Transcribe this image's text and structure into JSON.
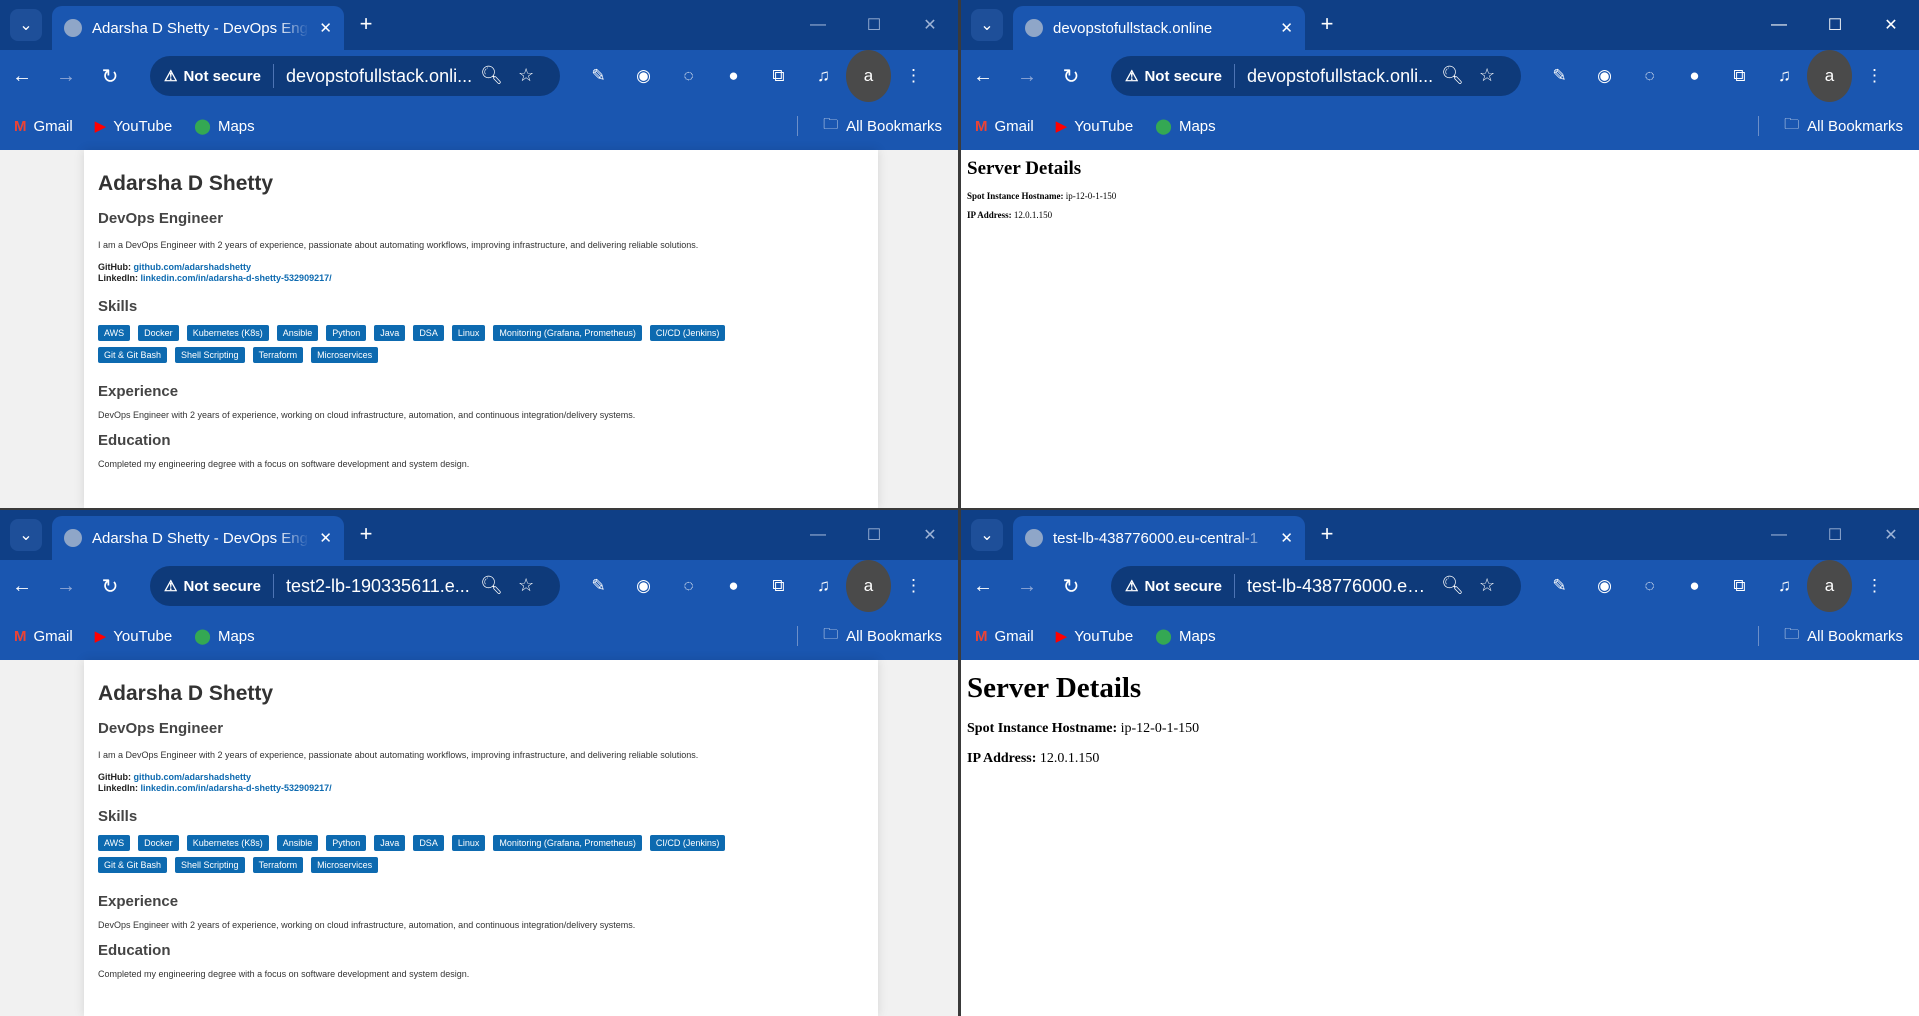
{
  "common": {
    "not_secure": "Not secure",
    "bookmarks": [
      "Gmail",
      "YouTube",
      "Maps"
    ],
    "all_bookmarks": "All Bookmarks",
    "avatar_letter": "a",
    "colors": {
      "chrome_dark": "#0f3f86",
      "chrome": "#1a56b0",
      "chip": "#0d6ab0"
    }
  },
  "windows": [
    {
      "tab_title": "Adarsha D Shetty - DevOps Eng",
      "url": "devopstofullstack.onli..."
    },
    {
      "tab_title": "devopstofullstack.online",
      "url": "devopstofullstack.onli..."
    },
    {
      "tab_title": "Adarsha D Shetty - DevOps Eng",
      "url": "test2-lb-190335611.e..."
    },
    {
      "tab_title": "test-lb-438776000.eu-central-1",
      "url": "test-lb-438776000.eu-..."
    }
  ],
  "resume": {
    "name": "Adarsha D Shetty",
    "role": "DevOps Engineer",
    "intro": "I am a DevOps Engineer with 2 years of experience, passionate about automating workflows, improving infrastructure, and delivering reliable solutions.",
    "github_label": "GitHub:",
    "github": "github.com/adarshadshetty",
    "linkedin_label": "LinkedIn:",
    "linkedin": "linkedin.com/in/adarsha-d-shetty-532909217/",
    "skills_heading": "Skills",
    "skills": [
      "AWS",
      "Docker",
      "Kubernetes (K8s)",
      "Ansible",
      "Python",
      "Java",
      "DSA",
      "Linux",
      "Monitoring (Grafana, Prometheus)",
      "CI/CD (Jenkins)",
      "Git & Git Bash",
      "Shell Scripting",
      "Terraform",
      "Microservices"
    ],
    "experience_heading": "Experience",
    "experience": "DevOps Engineer with 2 years of experience, working on cloud infrastructure, automation, and continuous integration/delivery systems.",
    "education_heading": "Education",
    "education": "Completed my engineering degree with a focus on software development and system design."
  },
  "server": {
    "title": "Server Details",
    "hostname_label": "Spot Instance Hostname:",
    "hostname": "ip-12-0-1-150",
    "ip_label": "IP Address:",
    "ip": "12.0.1.150"
  }
}
